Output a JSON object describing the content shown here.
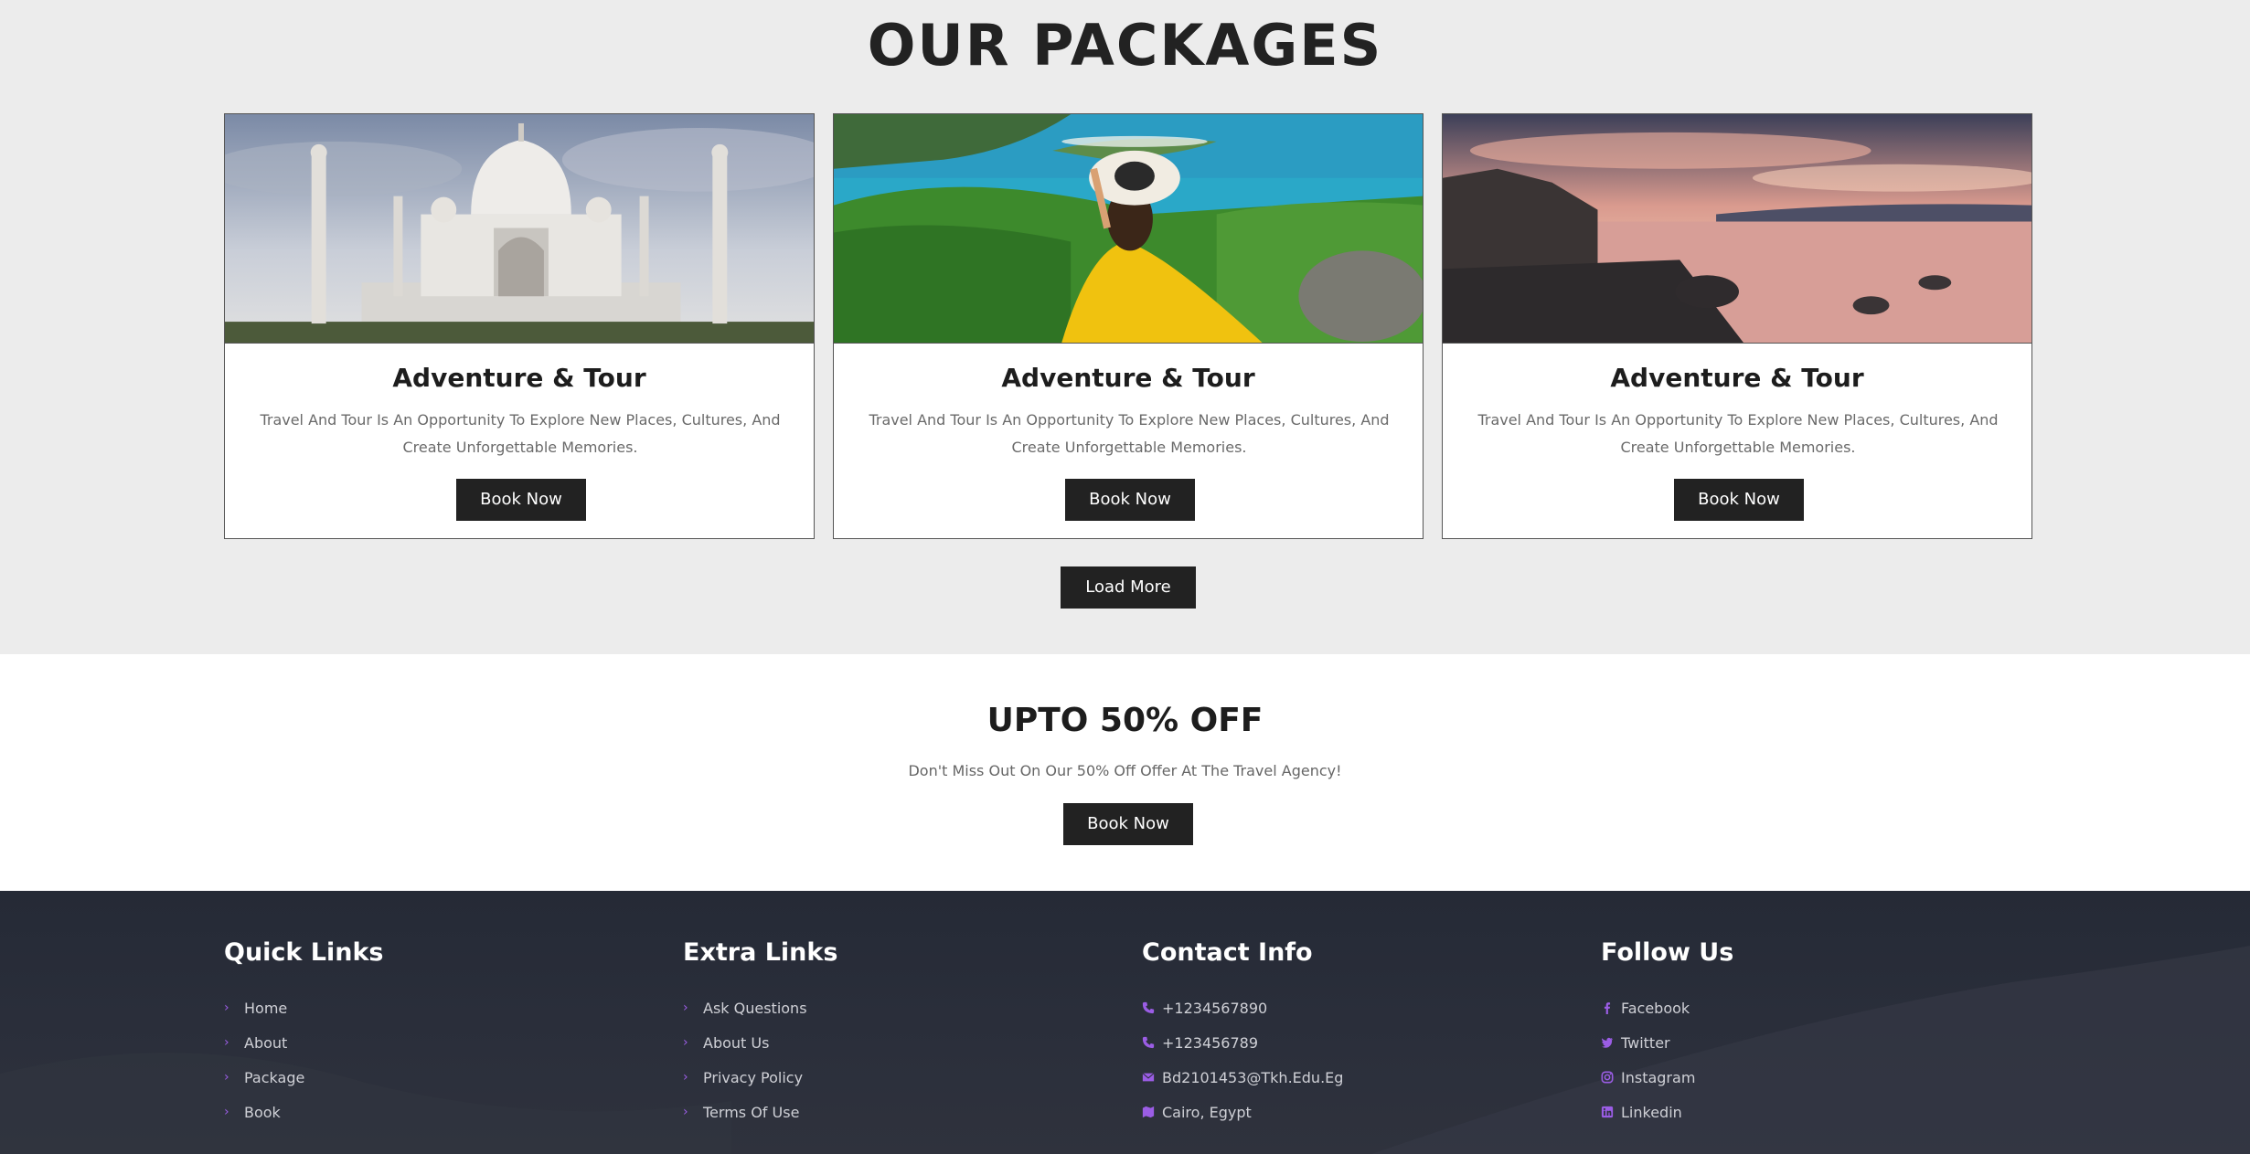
{
  "packages": {
    "title": "OUR PACKAGES",
    "cards": [
      {
        "image": "taj-mahal-photo",
        "title": "Adventure & Tour",
        "description": "Travel And Tour Is An Opportunity To Explore New Places, Cultures, And Create Unforgettable Memories.",
        "button": "Book Now"
      },
      {
        "image": "woman-in-yellow-dress-overlooking-bay-photo",
        "title": "Adventure & Tour",
        "description": "Travel And Tour Is An Opportunity To Explore New Places, Cultures, And Create Unforgettable Memories.",
        "button": "Book Now"
      },
      {
        "image": "rocky-lake-sunset-photo",
        "title": "Adventure & Tour",
        "description": "Travel And Tour Is An Opportunity To Explore New Places, Cultures, And Create Unforgettable Memories.",
        "button": "Book Now"
      }
    ],
    "load_more": "Load More"
  },
  "offer": {
    "title": "UPTO 50% OFF",
    "description": "Don't Miss Out On Our 50% Off Offer At The Travel Agency!",
    "button": "Book Now"
  },
  "footer": {
    "quick_links": {
      "title": "Quick Links",
      "items": [
        "Home",
        "About",
        "Package",
        "Book"
      ]
    },
    "extra_links": {
      "title": "Extra Links",
      "items": [
        "Ask Questions",
        "About Us",
        "Privacy Policy",
        "Terms Of Use"
      ]
    },
    "contact": {
      "title": "Contact Info",
      "items": [
        {
          "icon": "phone-icon",
          "text": "+1234567890"
        },
        {
          "icon": "phone-icon",
          "text": "+123456789"
        },
        {
          "icon": "envelope-icon",
          "text": "Bd2101453@Tkh.Edu.Eg"
        },
        {
          "icon": "map-icon",
          "text": "Cairo, Egypt"
        }
      ]
    },
    "follow": {
      "title": "Follow Us",
      "items": [
        {
          "icon": "facebook-icon",
          "text": "Facebook"
        },
        {
          "icon": "twitter-icon",
          "text": "Twitter"
        },
        {
          "icon": "instagram-icon",
          "text": "Instagram"
        },
        {
          "icon": "linkedin-icon",
          "text": "Linkedin"
        }
      ]
    }
  },
  "colors": {
    "button_bg": "#222222",
    "accent": "#9b5de5",
    "footer_bg": "#272b37",
    "section_bg": "#ececec"
  }
}
